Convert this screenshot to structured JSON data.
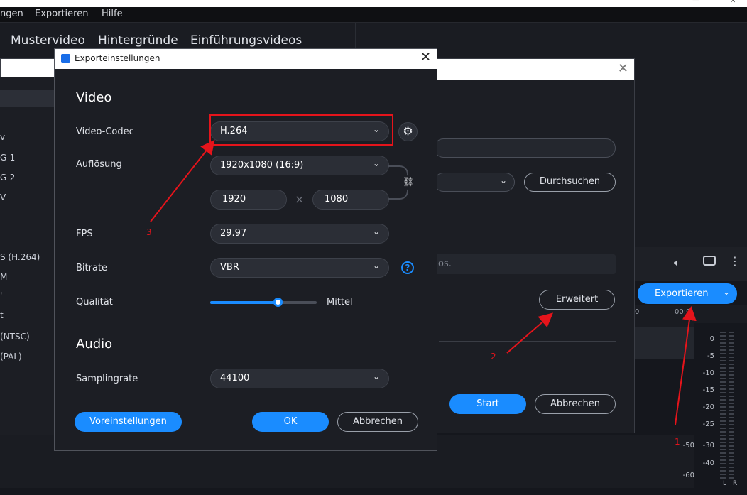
{
  "menu": {
    "items": [
      "ngen",
      "Exportieren",
      "Hilfe"
    ]
  },
  "tabs": [
    "Mustervideo",
    "Hintergründe",
    "Einführungsvideos"
  ],
  "left_list": [
    "v",
    "G-1",
    "G-2",
    "V",
    "S (H.264)",
    "M",
    "'",
    "t",
    "(NTSC)",
    "(PAL)"
  ],
  "back_dialog": {
    "browse_label": "Durchsuchen",
    "hint_text": "os.",
    "advanced_label": "Erweitert",
    "start_label": "Start",
    "cancel_label": "Abbrechen"
  },
  "right_panel": {
    "export_label": "Exportieren",
    "timeline_marks": [
      "0",
      "00:0"
    ],
    "meter_labels": [
      "0",
      "-5",
      "-10",
      "-15",
      "-20",
      "-25",
      "-30",
      "-40",
      "-50",
      "-60"
    ],
    "meter_channels": [
      "L",
      "R"
    ]
  },
  "dialog": {
    "title": "Exporteinstellungen",
    "video_heading": "Video",
    "codec_label": "Video-Codec",
    "codec_value": "H.264",
    "resolution_label": "Auflösung",
    "resolution_value": "1920x1080 (16:9)",
    "width_value": "1920",
    "height_value": "1080",
    "times": "×",
    "fps_label": "FPS",
    "fps_value": "29.97",
    "bitrate_label": "Bitrate",
    "bitrate_value": "VBR",
    "quality_label": "Qualität",
    "quality_value": "Mittel",
    "quality_level": 0.63,
    "audio_heading": "Audio",
    "samplerate_label": "Samplingrate",
    "samplerate_value": "44100",
    "presets_label": "Voreinstellungen",
    "ok_label": "OK",
    "cancel_label": "Abbrechen"
  },
  "annotations": [
    "1",
    "2",
    "3"
  ],
  "colors": {
    "accent": "#1a8cff",
    "highlight": "#e5141b",
    "background": "#1c1e24"
  }
}
